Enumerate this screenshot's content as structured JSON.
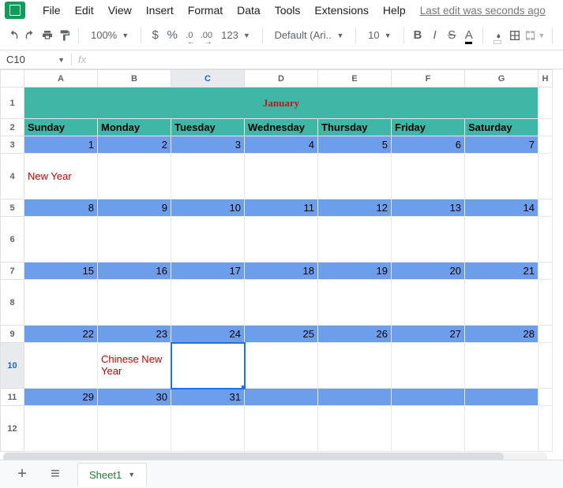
{
  "menubar": {
    "items": [
      "File",
      "Edit",
      "View",
      "Insert",
      "Format",
      "Data",
      "Tools",
      "Extensions",
      "Help"
    ],
    "last_edit": "Last edit was seconds ago"
  },
  "toolbar": {
    "zoom": "100%",
    "currency": "$",
    "percent": "%",
    "dec_dec": ".0",
    "dec_inc": ".00",
    "more_formats": "123",
    "font": "Default (Ari...",
    "font_size": "10",
    "bold": "B",
    "italic": "I",
    "strike": "S",
    "text_color": "A"
  },
  "namebox": {
    "ref": "C10",
    "fx": "fx"
  },
  "columns": [
    "A",
    "B",
    "C",
    "D",
    "E",
    "F",
    "G",
    "H"
  ],
  "rows": [
    "1",
    "2",
    "3",
    "4",
    "5",
    "6",
    "7",
    "8",
    "9",
    "10",
    "11",
    "12"
  ],
  "calendar": {
    "title": "January",
    "days": [
      "Sunday",
      "Monday",
      "Tuesday",
      "Wednesday",
      "Thursday",
      "Friday",
      "Saturday"
    ],
    "weeks": [
      [
        "1",
        "2",
        "3",
        "4",
        "5",
        "6",
        "7"
      ],
      [
        "8",
        "9",
        "10",
        "11",
        "12",
        "13",
        "14"
      ],
      [
        "15",
        "16",
        "17",
        "18",
        "19",
        "20",
        "21"
      ],
      [
        "22",
        "23",
        "24",
        "25",
        "26",
        "27",
        "28"
      ],
      [
        "29",
        "30",
        "31",
        "",
        "",
        "",
        ""
      ]
    ],
    "notes": {
      "w0c0": "New Year",
      "w3c1": "Chinese New Year"
    }
  },
  "sheet_tabs": {
    "active": "Sheet1"
  }
}
